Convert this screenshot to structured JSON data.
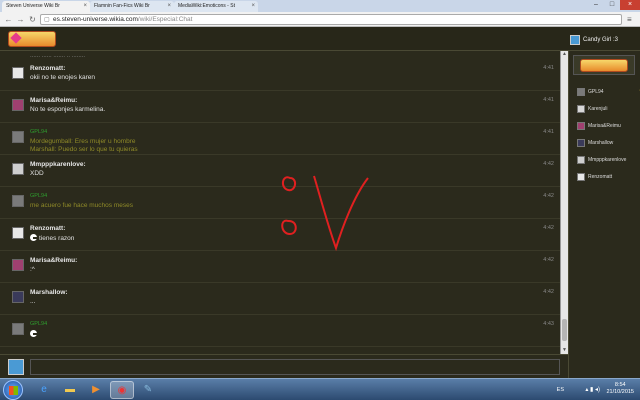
{
  "browser": {
    "tabs": [
      {
        "label": "Steven Universe Wiki Br",
        "active": true
      },
      {
        "label": "Flamnin Fan-Fics Wiki Br",
        "active": false
      },
      {
        "label": "MediaWiki:Emoticons - St",
        "active": false
      }
    ],
    "url_host": "es.steven-universe.wikia.com",
    "url_path": "/wiki/Especial:Chat"
  },
  "header": {
    "current_user": "Candy Girl :3"
  },
  "chat": {
    "cut_top_text": "...... ...... ....... .. ........",
    "messages": [
      {
        "user": "Renzomatt:",
        "text": "okii no te enojes karen",
        "time": "4:41",
        "green": false,
        "avatar_color": "#e8e8e8"
      },
      {
        "user": "Marisa&Reimu:",
        "text": "No te esponjes karmelina.",
        "time": "4:41",
        "green": false,
        "avatar_color": "#a04070"
      },
      {
        "user": "GPL94",
        "text": "Mordegumball: Eres mujer u hombre\nMarshall: Puedo ser lo que tu quieras",
        "time": "4:41",
        "green": true,
        "avatar_color": "#7a7a7a"
      },
      {
        "user": "Mmpppkarenlove:",
        "text": "XDD",
        "time": "4:42",
        "green": false,
        "avatar_color": "#cfcfcf"
      },
      {
        "user": "GPL94",
        "text": "me acuero fue hace muchos meses",
        "time": "4:42",
        "green": true,
        "avatar_color": "#7a7a7a"
      },
      {
        "user": "Renzomatt:",
        "text": "tienes razon",
        "time": "4:42",
        "green": false,
        "avatar_color": "#e8e8e8",
        "smiley": true
      },
      {
        "user": "Marisa&Reimu:",
        "text": ":^",
        "time": "4:42",
        "green": false,
        "avatar_color": "#a04070"
      },
      {
        "user": "Marshallow:",
        "text": "...",
        "time": "4:42",
        "green": false,
        "avatar_color": "#3a3a5a"
      },
      {
        "user": "GPL94",
        "text": "",
        "time": "4:43",
        "green": true,
        "avatar_color": "#7a7a7a",
        "smiley": true
      }
    ]
  },
  "userlist": {
    "users": [
      {
        "name": "GPL94",
        "avatar_color": "#7a7a7a",
        "star": true
      },
      {
        "name": "Karenjuli",
        "avatar_color": "#d8d8d8",
        "star": false
      },
      {
        "name": "Marisa&Reimu",
        "avatar_color": "#a04070",
        "star": false
      },
      {
        "name": "Marshallow",
        "avatar_color": "#3a3a5a",
        "star": false
      },
      {
        "name": "Mmpppkarenlove",
        "avatar_color": "#cfcfcf",
        "star": false
      },
      {
        "name": "Renzomatt",
        "avatar_color": "#e8e8e8",
        "star": false
      }
    ]
  },
  "taskbar": {
    "language": "ES",
    "time": "8:54",
    "date": "21/10/2015"
  },
  "colors": {
    "chat_bg": "#2b2a1c",
    "green_name": "#2e9e2e",
    "green_text": "#8f8a28",
    "drawing_red": "#e02020"
  }
}
